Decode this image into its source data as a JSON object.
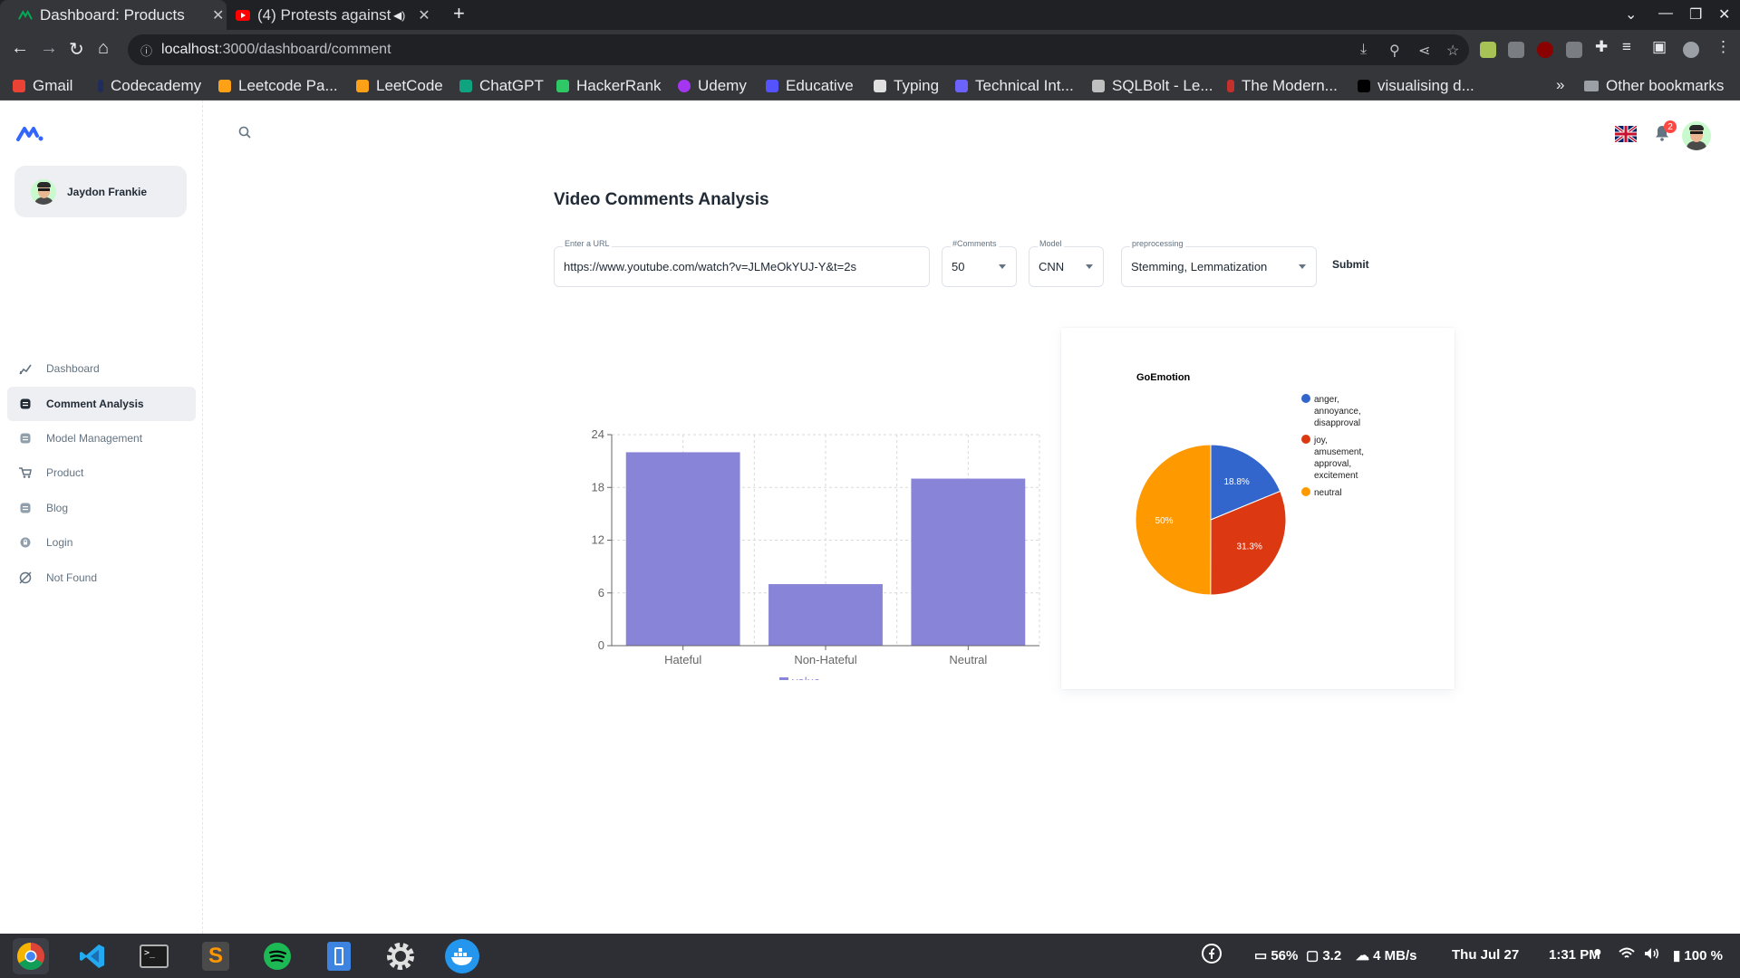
{
  "browser": {
    "tabs": [
      {
        "title": "Dashboard: Products",
        "active": true
      },
      {
        "title": "(4) Protests against",
        "active": false,
        "audio": true
      }
    ],
    "url_host": "localhost",
    "url_path": ":3000/dashboard/comment",
    "bookmarks": [
      "Gmail",
      "Codecademy",
      "Leetcode Pa...",
      "LeetCode",
      "ChatGPT",
      "HackerRank",
      "Udemy",
      "Educative",
      "Typing",
      "Technical Int...",
      "SQLBolt - Le...",
      "The Modern...",
      "visualising d..."
    ],
    "other_bookmarks": "Other bookmarks"
  },
  "app": {
    "user": {
      "name": "Jaydon Frankie"
    },
    "nav": [
      {
        "label": "Dashboard",
        "icon": "chart-icon",
        "active": false
      },
      {
        "label": "Comment Analysis",
        "icon": "document-icon",
        "active": true
      },
      {
        "label": "Model Management",
        "icon": "document-icon",
        "active": false
      },
      {
        "label": "Product",
        "icon": "cart-icon",
        "active": false
      },
      {
        "label": "Blog",
        "icon": "document-icon",
        "active": false
      },
      {
        "label": "Login",
        "icon": "lock-icon",
        "active": false
      },
      {
        "label": "Not Found",
        "icon": "block-icon",
        "active": false
      }
    ],
    "notification_count": "2",
    "page_title": "Video Comments Analysis",
    "form": {
      "url_label": "Enter a URL",
      "url_value": "https://www.youtube.com/watch?v=JLMeOkYUJ-Y&t=2s",
      "comments_label": "#Comments",
      "comments_value": "50",
      "model_label": "Model",
      "model_value": "CNN",
      "preprocessing_label": "preprocessing",
      "preprocessing_value": "Stemming, Lemmatization",
      "submit_label": "Submit"
    }
  },
  "chart_data": [
    {
      "type": "bar",
      "categories": [
        "Hateful",
        "Non-Hateful",
        "Neutral"
      ],
      "series": [
        {
          "name": "value",
          "values": [
            22,
            7,
            19
          ]
        }
      ],
      "ylim": [
        0,
        24
      ],
      "yticks": [
        0,
        6,
        12,
        18,
        24
      ],
      "grid": true,
      "legend": "bottom",
      "color": "#8884d8"
    },
    {
      "type": "pie",
      "title": "GoEmotion",
      "labels": [
        "anger, annoyance, disapproval",
        "joy, amusement, approval, excitement",
        "neutral"
      ],
      "values": [
        18.8,
        31.3,
        50
      ],
      "value_labels": [
        "18.8%",
        "31.3%",
        "50%"
      ],
      "colors": [
        "#3366cc",
        "#dc3912",
        "#ff9900"
      ],
      "legend": "right"
    }
  ],
  "taskbar": {
    "apps": [
      "chrome-icon",
      "vscode-icon",
      "terminal-icon",
      "sublime-icon",
      "spotify-icon",
      "files-icon",
      "settings-icon",
      "docker-icon"
    ],
    "disk": "56%",
    "load": "3.2",
    "net": "4 MB/s",
    "date": "Thu Jul 27",
    "time": "1:31 PM",
    "battery": "100 %"
  }
}
